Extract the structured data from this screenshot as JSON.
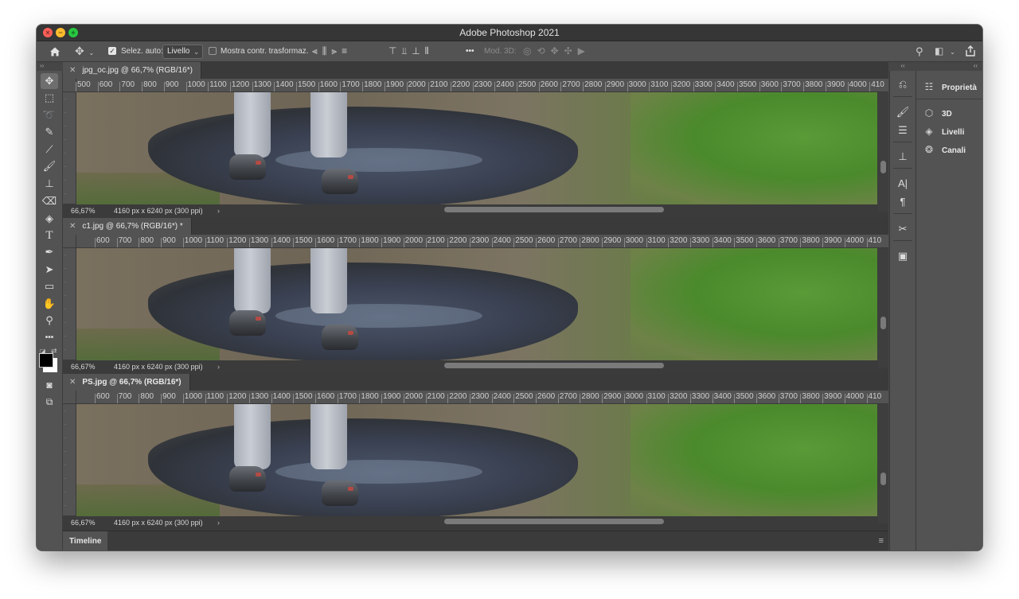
{
  "app": {
    "title": "Adobe Photoshop 2021"
  },
  "options_bar": {
    "home_icon": "home-icon",
    "move_icon": "move-tool-icon",
    "auto_select_label": "Selez. auto:",
    "auto_select_checked": true,
    "auto_select_value": "Livello",
    "show_transform_label": "Mostra contr. trasformaz.",
    "show_transform_checked": false,
    "more_label": "•••",
    "mode3d_label": "Mod. 3D:",
    "search_icon": "search-icon",
    "workspace_icon": "workspace-icon",
    "share_icon": "share-icon"
  },
  "tools": [
    {
      "name": "move-tool",
      "glyph": "✥"
    },
    {
      "name": "rectangular-marquee-tool",
      "glyph": "⬚"
    },
    {
      "name": "lasso-tool",
      "glyph": "➰"
    },
    {
      "name": "quick-selection-tool",
      "glyph": "✎"
    },
    {
      "name": "eyedropper-tool",
      "glyph": "⟋"
    },
    {
      "name": "brush-tool",
      "glyph": "🖌"
    },
    {
      "name": "clone-stamp-tool",
      "glyph": "⊥"
    },
    {
      "name": "eraser-tool",
      "glyph": "⌫"
    },
    {
      "name": "paint-bucket-tool",
      "glyph": "◈"
    },
    {
      "name": "type-tool",
      "glyph": "T"
    },
    {
      "name": "pen-tool",
      "glyph": "✒"
    },
    {
      "name": "path-selection-tool",
      "glyph": "➤"
    },
    {
      "name": "rectangle-tool",
      "glyph": "▭"
    },
    {
      "name": "hand-tool",
      "glyph": "✋"
    },
    {
      "name": "zoom-tool",
      "glyph": "⚲"
    },
    {
      "name": "edit-toolbar",
      "glyph": "•••"
    }
  ],
  "documents": [
    {
      "tab_title": "jpg_oc.jpg @ 66,7% (RGB/16*)",
      "ruler_labels": [
        "500",
        "600",
        "700",
        "800",
        "900",
        "1000",
        "1100",
        "1200",
        "1300",
        "1400",
        "1500",
        "1600",
        "1700",
        "1800",
        "1900",
        "2000",
        "2100",
        "2200",
        "2300",
        "2400",
        "2500",
        "2600",
        "2700",
        "2800",
        "2900",
        "3000",
        "3100",
        "3200",
        "3300",
        "3400",
        "3500",
        "3600",
        "3700",
        "3800",
        "3900",
        "4000",
        "410"
      ],
      "zoom": "66,67%",
      "dimensions": "4160 px x 6240 px (300 ppi)"
    },
    {
      "tab_title": "c1.jpg @ 66,7% (RGB/16*) *",
      "ruler_labels": [
        "600",
        "700",
        "800",
        "900",
        "1000",
        "1100",
        "1200",
        "1300",
        "1400",
        "1500",
        "1600",
        "1700",
        "1800",
        "1900",
        "2000",
        "2100",
        "2200",
        "2300",
        "2400",
        "2500",
        "2600",
        "2700",
        "2800",
        "2900",
        "3000",
        "3100",
        "3200",
        "3300",
        "3400",
        "3500",
        "3600",
        "3700",
        "3800",
        "3900",
        "4000",
        "410"
      ],
      "zoom": "66,67%",
      "dimensions": "4160 px x 6240 px (300 ppi)"
    },
    {
      "tab_title": "PS.jpg @ 66,7% (RGB/16*)",
      "ruler_labels": [
        "600",
        "700",
        "800",
        "900",
        "1000",
        "1100",
        "1200",
        "1300",
        "1400",
        "1500",
        "1600",
        "1700",
        "1800",
        "1900",
        "2000",
        "2100",
        "2200",
        "2300",
        "2400",
        "2500",
        "2600",
        "2700",
        "2800",
        "2900",
        "3000",
        "3100",
        "3200",
        "3300",
        "3400",
        "3500",
        "3600",
        "3700",
        "3800",
        "3900",
        "4000",
        "410"
      ],
      "zoom": "66,67%",
      "dimensions": "4160 px x 6240 px (300 ppi)"
    }
  ],
  "timeline": {
    "tab_label": "Timeline"
  },
  "right_panel": {
    "items": [
      {
        "label": "Proprietà",
        "icon": "properties-icon"
      },
      {
        "label": "3D",
        "icon": "cube-icon"
      },
      {
        "label": "Livelli",
        "icon": "layers-icon"
      },
      {
        "label": "Canali",
        "icon": "channels-icon"
      }
    ]
  }
}
